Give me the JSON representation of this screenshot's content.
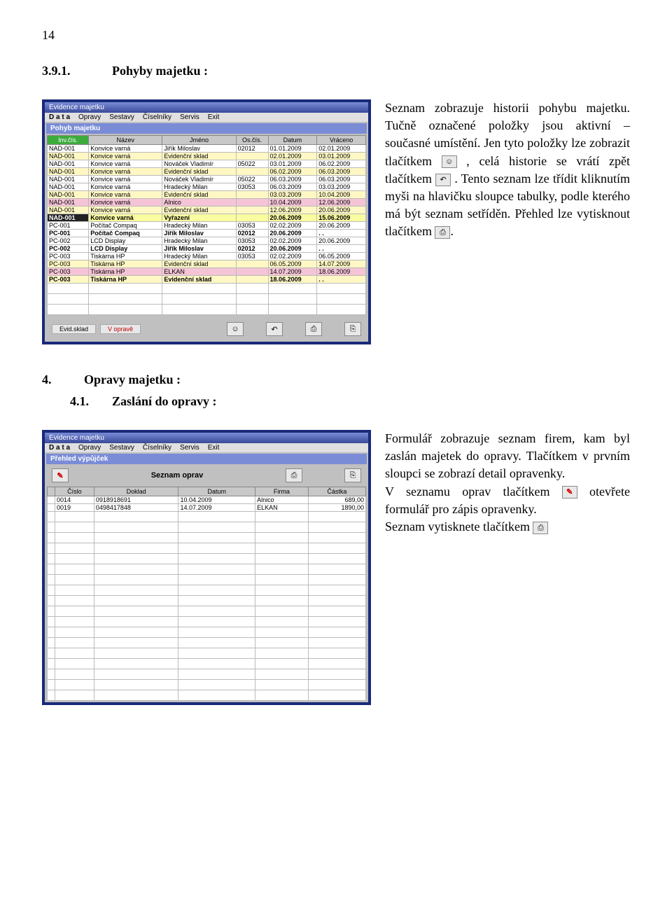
{
  "page_number": "14",
  "s391": {
    "num": "3.9.1.",
    "title": "Pohyby majetku :"
  },
  "p1": {
    "a": "Seznam zobrazuje historii pohybu majetku. Tučně označené položky jsou aktivní – současné umístění. Jen tyto položky lze zobrazit tlačítkem ",
    "b": ", celá historie se vrátí zpět tlačítkem ",
    "c": ". Tento seznam lze třídit kliknutím myši na hlavičku sloupce tabulky, podle kterého má být seznam setříděn. Přehled lze vytisknout tlačítkem ",
    "d": "."
  },
  "icons": {
    "smile": "☺",
    "undo": "↶",
    "print": "⎙",
    "close": "⎘",
    "pencil": "✎"
  },
  "s4": {
    "num": "4.",
    "title": "Opravy majetku :"
  },
  "s41": {
    "num": "4.1.",
    "title": "Zaslání do opravy :"
  },
  "p2": {
    "a": "Formulář zobrazuje seznam firem, kam byl zaslán majetek do opravy. Tlačítkem  v prvním sloupci se zobrazí detail opravenky.",
    "b": "V seznamu oprav tlačítkem ",
    "c": " otevřete formulář pro zápis opravenky.",
    "d": "Seznam vytisknete tlačítkem "
  },
  "win1": {
    "title": "Evidence majetku",
    "menu": [
      "D a t a",
      "Opravy",
      "Sestavy",
      "Číselníky",
      "Servis",
      "Exit"
    ],
    "form": "Pohyb majetku",
    "headers": [
      "Inv.čís.",
      "Název",
      "Jméno",
      "Os.čís.",
      "Datum",
      "Vráceno"
    ],
    "legend": {
      "a": "Evid.sklad",
      "b": "V opravě"
    },
    "rows": [
      {
        "c": [
          "NAD-001",
          "Konvice varná",
          "Jiřík Miloslav",
          "02012",
          "01.01.2009",
          "02.01.2009"
        ]
      },
      {
        "c": [
          "NAD-001",
          "Konvice varná",
          "Evidenční sklad",
          "",
          "02.01.2009",
          "03.01.2009"
        ],
        "cls": "yellow"
      },
      {
        "c": [
          "NAD-001",
          "Konvice varná",
          "Nováček Vladimír",
          "05022",
          "03.01.2009",
          "06.02.2009"
        ]
      },
      {
        "c": [
          "NAD-001",
          "Konvice varná",
          "Evidenční sklad",
          "",
          "06.02.2009",
          "06.03.2009"
        ],
        "cls": "yellow"
      },
      {
        "c": [
          "NAD-001",
          "Konvice varná",
          "Nováček Vladimír",
          "05022",
          "06.03.2009",
          "06.03.2009"
        ]
      },
      {
        "c": [
          "NAD-001",
          "Konvice varná",
          "Hradecký Milan",
          "03053",
          "06.03.2009",
          "03.03.2009"
        ]
      },
      {
        "c": [
          "NAD-001",
          "Konvice varná",
          "Evidenční sklad",
          "",
          "03.03.2009",
          "10.04.2009"
        ],
        "cls": "yellow"
      },
      {
        "c": [
          "NAD-001",
          "Konvice varná",
          "Alnico",
          "",
          "10.04.2009",
          "12.06.2009"
        ],
        "cls": "pink"
      },
      {
        "c": [
          "NAD-001",
          "Konvice varná",
          "Evidenční sklad",
          "",
          "12.06.2009",
          "20.06.2009"
        ],
        "cls": "yellow"
      },
      {
        "c": [
          "NAD-001",
          "Konvice varná",
          "Vyřazení",
          "",
          "20.06.2009",
          "15.06.2009"
        ],
        "cls": "bold sel"
      },
      {
        "c": [
          "PC-001",
          "Počítač Compaq",
          "Hradecký Milan",
          "03053",
          "02.02.2009",
          "20.06.2009"
        ]
      },
      {
        "c": [
          "PC-001",
          "Počítač Compaq",
          "Jiřík Miloslav",
          "02012",
          "20.06.2009",
          ". ."
        ],
        "cls": "bold"
      },
      {
        "c": [
          "PC-002",
          "LCD Display",
          "Hradecký Milan",
          "03053",
          "02.02.2009",
          "20.06.2009"
        ]
      },
      {
        "c": [
          "PC-002",
          "LCD Display",
          "Jiřík Miloslav",
          "02012",
          "20.06.2009",
          ". ."
        ],
        "cls": "bold"
      },
      {
        "c": [
          "PC-003",
          "Tiskárna HP",
          "Hradecký Milan",
          "03053",
          "02.02.2009",
          "06.05.2009"
        ]
      },
      {
        "c": [
          "PC-003",
          "Tiskárna HP",
          "Evidenční sklad",
          "",
          "06.05.2009",
          "14.07.2009"
        ],
        "cls": "yellow"
      },
      {
        "c": [
          "PC-003",
          "Tiskárna HP",
          "ELKAN",
          "",
          "14.07.2009",
          "18.06.2009"
        ],
        "cls": "pink"
      },
      {
        "c": [
          "PC-003",
          "Tiskárna HP",
          "Evidenční sklad",
          "",
          "18.06.2009",
          ". ."
        ],
        "cls": "yellow bold"
      }
    ]
  },
  "win2": {
    "title": "Evidence majetku",
    "menu": [
      "D a t a",
      "Opravy",
      "Sestavy",
      "Číselníky",
      "Servis",
      "Exit"
    ],
    "form": "Přehled výpůjček",
    "title2": "Seznam oprav",
    "headers": [
      "",
      "Číslo",
      "Doklad",
      "Datum",
      "Firma",
      "Částka"
    ],
    "rows": [
      {
        "c": [
          "",
          "0014",
          "0918918691",
          "10.04.2009",
          "Alnico",
          "689,00"
        ]
      },
      {
        "c": [
          "",
          "0019",
          "0498417848",
          "14.07.2009",
          "ELKAN",
          "1890,00"
        ]
      }
    ]
  }
}
